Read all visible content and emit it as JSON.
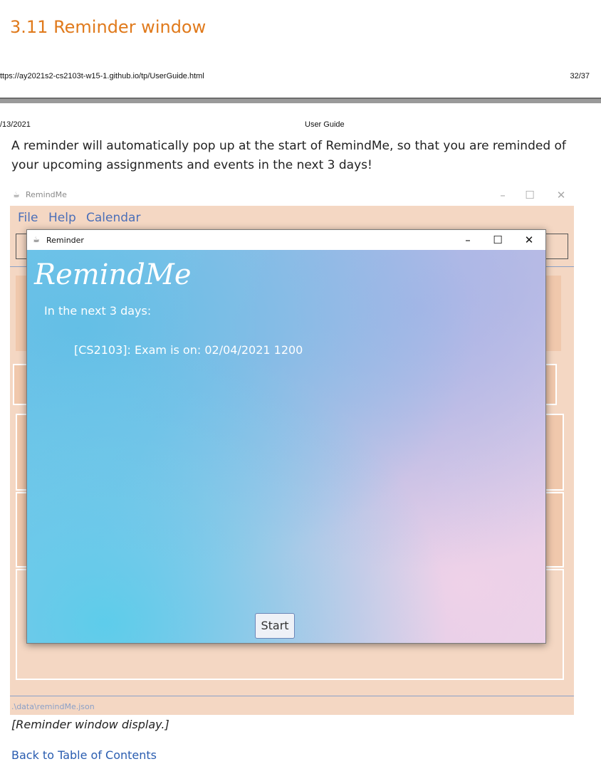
{
  "section": {
    "title": "3.11 Reminder window"
  },
  "print_header": {
    "url": "ttps://ay2021s2-cs2103t-w15-1.github.io/tp/UserGuide.html",
    "page": "32/37",
    "date": "/13/2021",
    "doc_title": "User Guide"
  },
  "intro": "A reminder will automatically pop up at the start of RemindMe, so that you are reminded of your upcoming assignments and events in the next 3 days!",
  "app_window": {
    "title": "RemindMe",
    "menu": [
      "File",
      "Help",
      "Calendar"
    ],
    "status_path": ".\\data\\remindMe.json"
  },
  "reminder_window": {
    "title": "Reminder",
    "logo_text": "RemindMe",
    "subtitle": "In the next 3 days:",
    "items": [
      "[CS2103]: Exam is on: 02/04/2021 1200"
    ],
    "start_label": "Start"
  },
  "caption": "[Reminder window display.]",
  "back_link": "Back to Table of Contents",
  "colors": {
    "accent_title": "#e07a1c",
    "link": "#2a5db0",
    "app_bg": "#f4d7c3"
  }
}
